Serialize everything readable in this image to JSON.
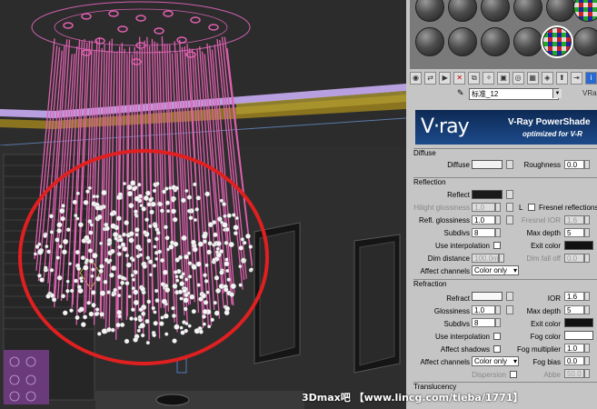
{
  "material_editor": {
    "material_name": "标准_12",
    "renderer_label": "VRay",
    "banner": {
      "logo": "V·ray",
      "title": "V-Ray PowerShade",
      "subtitle": "optimized for V-R"
    }
  },
  "diffuse": {
    "section": "Diffuse",
    "diffuse_label": "Diffuse",
    "roughness_label": "Roughness",
    "roughness_value": "0.0"
  },
  "reflection": {
    "section": "Reflection",
    "reflect_label": "Reflect",
    "hilight_label": "Hilight glossiness",
    "hilight_value": "1.0",
    "refl_gloss_label": "Refl. glossiness",
    "refl_gloss_value": "1.0",
    "subdivs_label": "Subdivs",
    "subdivs_value": "8",
    "fresnel_label": "Fresnel reflections",
    "fresnel_ior_label": "Fresnel IOR",
    "fresnel_ior_value": "1.6",
    "max_depth_label": "Max depth",
    "max_depth_value": "5",
    "use_interp_label": "Use interpolation",
    "exit_color_label": "Exit color",
    "dim_distance_label": "Dim distance",
    "dim_distance_value": "100.0m",
    "dim_falloff_label": "Dim fall off",
    "dim_falloff_value": "0.0",
    "affect_channels_label": "Affect channels",
    "affect_channels_value": "Color only"
  },
  "refraction": {
    "section": "Refraction",
    "refract_label": "Refract",
    "ior_label": "IOR",
    "ior_value": "1.6",
    "glossiness_label": "Glossiness",
    "glossiness_value": "1.0",
    "max_depth_label": "Max depth",
    "max_depth_value": "5",
    "subdivs_label": "Subdivs",
    "subdivs_value": "8",
    "exit_color_label": "Exit color",
    "use_interp_label": "Use interpolation",
    "fog_color_label": "Fog color",
    "affect_shadows_label": "Affect shadows",
    "fog_multiplier_label": "Fog multiplier",
    "fog_multiplier_value": "1.0",
    "affect_channels_label": "Affect channels",
    "affect_channels_value": "Color only",
    "fog_bias_label": "Fog bias",
    "fog_bias_value": "0.0",
    "dispersion_label": "Dispersion",
    "abbe_label": "Abbe",
    "abbe_value": "50.0"
  },
  "translucency": {
    "section": "Translucency"
  },
  "watermark": "3Dmax吧 【www.lincg.com/tieba/1771】",
  "colors": {
    "annotation_circle": "#e02020",
    "crystal_strands": "#e060b0",
    "banner_blue": "#1c4a8a"
  }
}
